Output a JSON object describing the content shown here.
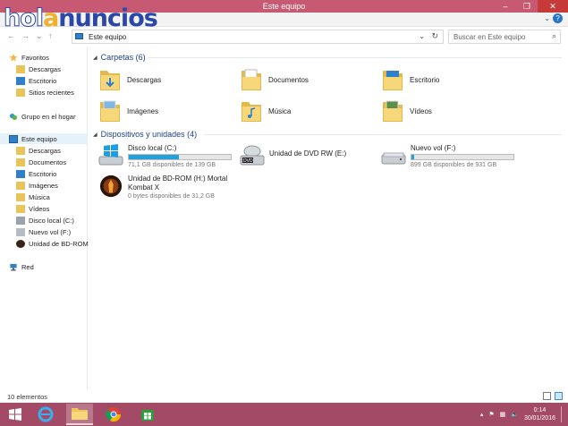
{
  "window": {
    "title": "Este equipo",
    "buttons": {
      "minimize": "–",
      "maximize": "❐",
      "close": "✕"
    }
  },
  "watermark": {
    "part1": "hol",
    "part2": "a",
    "part3": "nuncios"
  },
  "ribbon": {
    "expand": "⌄",
    "help": "?"
  },
  "address": {
    "crumb": "Este equipo",
    "search_placeholder": "Buscar en Este equipo"
  },
  "nav": {
    "favoritos": "Favoritos",
    "descargas": "Descargas",
    "escritorio": "Escritorio",
    "sitios_recientes": "Sitios recientes",
    "grupo_hogar": "Grupo en el hogar",
    "este_equipo": "Este equipo",
    "pc_items": [
      "Descargas",
      "Documentos",
      "Escritorio",
      "Imágenes",
      "Música",
      "Vídeos",
      "Disco local (C:)",
      "Nuevo vol (F:)",
      "Unidad de BD-ROM"
    ],
    "red": "Red"
  },
  "groups": {
    "carpetas": "Carpetas (6)",
    "dispositivos": "Dispositivos y unidades (4)"
  },
  "folders": [
    "Descargas",
    "Documentos",
    "Escritorio",
    "Imágenes",
    "Música",
    "Vídeos"
  ],
  "drives": [
    {
      "name": "Disco local (C:)",
      "free": "71,1 GB disponibles de 139 GB",
      "used_fraction": 0.49
    },
    {
      "name": "Unidad de DVD RW (E:)"
    },
    {
      "name": "Nuevo vol (F:)",
      "free": "899 GB disponibles de 931 GB",
      "used_fraction": 0.03
    },
    {
      "name_line1": "Unidad de BD-ROM (H:) Mortal",
      "name_line2": "Kombat X",
      "free": "0 bytes disponibles de 31,2 GB"
    }
  ],
  "status": {
    "count": "10 elementos"
  },
  "taskbar": {
    "time": "0:14",
    "date": "30/01/2016"
  },
  "colors": {
    "titlebar": "#c75a72",
    "taskbar": "#a24a66",
    "accent": "#26a0da",
    "group_header": "#1e3f8a"
  }
}
